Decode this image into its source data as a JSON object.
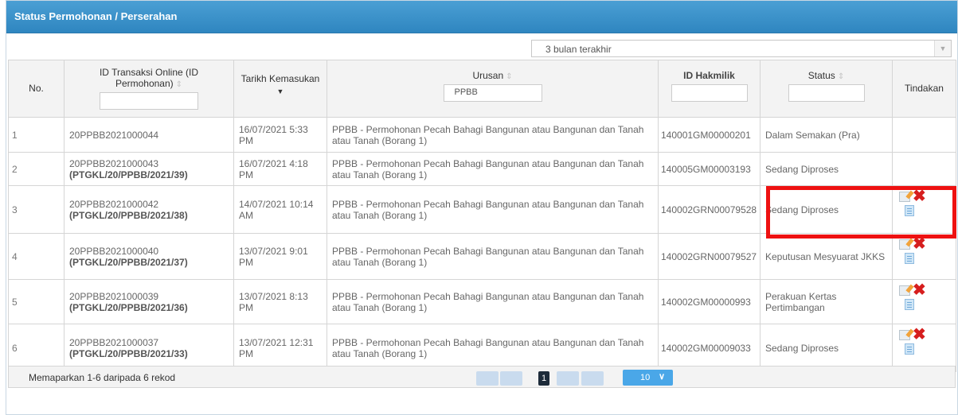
{
  "panel": {
    "title": "Status Permohonan / Perserahan"
  },
  "filter": {
    "period": "3 bulan terakhir"
  },
  "table": {
    "headers": {
      "no": "No.",
      "id": "ID Transaksi Online (ID Permohonan)",
      "tarikh": "Tarikh Kemasukan",
      "urusan": "Urusan",
      "hakmilik": "ID Hakmilik",
      "status": "Status",
      "tindakan": "Tindakan"
    },
    "filters": {
      "id": "",
      "urusan": "PPBB",
      "hakmilik": "",
      "status": ""
    },
    "rows": [
      {
        "no": "1",
        "id": "20PPBB2021000044",
        "ref": "",
        "tarikh": "16/07/2021 5:33 PM",
        "urusan": "PPBB - Permohonan Pecah Bahagi Bangunan atau Bangunan dan Tanah atau Tanah (Borang 1)",
        "hakmilik": "140001GM00000201",
        "status": "Dalam Semakan (Pra)",
        "actions": false
      },
      {
        "no": "2",
        "id": "20PPBB2021000043",
        "ref": "(PTGKL/20/PPBB/2021/39)",
        "tarikh": "16/07/2021 4:18 PM",
        "urusan": "PPBB - Permohonan Pecah Bahagi Bangunan atau Bangunan dan Tanah atau Tanah (Borang 1)",
        "hakmilik": "140005GM00003193",
        "status": "Sedang Diproses",
        "actions": false
      },
      {
        "no": "3",
        "id": "20PPBB2021000042",
        "ref": "(PTGKL/20/PPBB/2021/38)",
        "tarikh": "14/07/2021 10:14 AM",
        "urusan": "PPBB - Permohonan Pecah Bahagi Bangunan atau Bangunan dan Tanah atau Tanah (Borang 1)",
        "hakmilik": "140002GRN00079528",
        "status": "Sedang Diproses",
        "actions": true
      },
      {
        "no": "4",
        "id": "20PPBB2021000040",
        "ref": "(PTGKL/20/PPBB/2021/37)",
        "tarikh": "13/07/2021 9:01 PM",
        "urusan": "PPBB - Permohonan Pecah Bahagi Bangunan atau Bangunan dan Tanah atau Tanah (Borang 1)",
        "hakmilik": "140002GRN00079527",
        "status": "Keputusan Mesyuarat JKKS",
        "actions": true
      },
      {
        "no": "5",
        "id": "20PPBB2021000039",
        "ref": "(PTGKL/20/PPBB/2021/36)",
        "tarikh": "13/07/2021 8:13 PM",
        "urusan": "PPBB - Permohonan Pecah Bahagi Bangunan atau Bangunan dan Tanah atau Tanah (Borang 1)",
        "hakmilik": "140002GM00000993",
        "status": "Perakuan Kertas Pertimbangan",
        "actions": true
      },
      {
        "no": "6",
        "id": "20PPBB2021000037",
        "ref": "(PTGKL/20/PPBB/2021/33)",
        "tarikh": "13/07/2021 12:31 PM",
        "urusan": "PPBB - Permohonan Pecah Bahagi Bangunan atau Bangunan dan Tanah atau Tanah (Borang 1)",
        "hakmilik": "140002GM00009033",
        "status": "Sedang Diproses",
        "actions": true
      }
    ]
  },
  "footer": {
    "summary": "Memaparkan 1-6 daripada 6 rekod",
    "current_page": "1",
    "page_size": "10"
  },
  "colors": {
    "header": "#3a93cc",
    "highlight": "#ee1111",
    "delete": "#d61e1e"
  }
}
